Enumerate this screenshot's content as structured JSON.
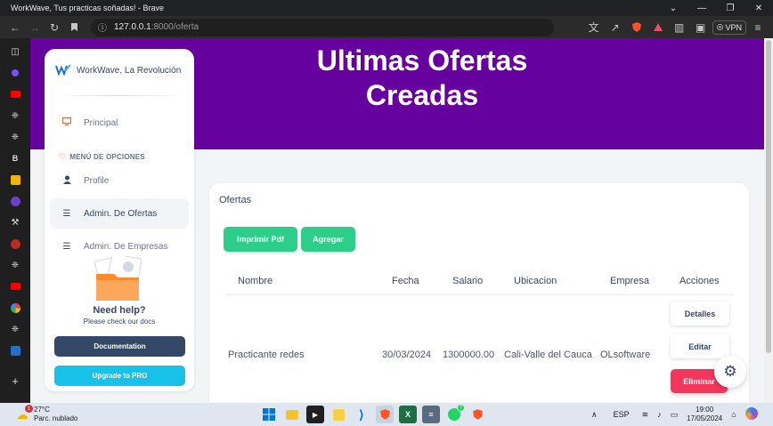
{
  "window": {
    "title": "WorkWave, Tus practicas soñadas! - Brave",
    "controls": {
      "menu": "⌄",
      "minimize": "—",
      "maximize": "❐",
      "close": "✕"
    }
  },
  "browser": {
    "url_host": "127.0.0.1",
    "url_path": ":8000/oferta",
    "vpn_label": "VPN"
  },
  "sidebar": {
    "brand": "WorkWave, La Revolución",
    "items": [
      {
        "label": "Principal",
        "icon": "monitor-icon"
      },
      {
        "label": "Profile",
        "icon": "user-icon"
      },
      {
        "label": "Admin. De Ofertas",
        "icon": "list-icon",
        "active": true
      },
      {
        "label": "Admin. De Empresas",
        "icon": "list-icon"
      }
    ],
    "menu_heading": "MENÚ DE OPCIONES",
    "help_title": "Need help?",
    "help_subtitle": "Please check our docs",
    "doc_button": "Documentation",
    "pro_button": "Upgrade to PRO"
  },
  "hero": {
    "title": "Ultimas Ofertas Creadas"
  },
  "card": {
    "title": "Ofertas",
    "print_button": "Imprimir Pdf",
    "add_button": "Agregar",
    "columns": [
      "Nombre",
      "Fecha",
      "Salario",
      "Ubicacion",
      "Empresa",
      "Acciones"
    ],
    "rows": [
      {
        "nombre": "Practicante redes",
        "fecha": "30/03/2024",
        "salario": "1300000.00",
        "ubicacion": "Cali-Valle del Cauca",
        "empresa": "OLsoftware",
        "actions": {
          "details": "Detalles",
          "edit": "Editar",
          "delete": "Eliminar"
        }
      }
    ]
  },
  "taskbar": {
    "temperature": "27°C",
    "weather": "Parc. nublado",
    "weather_badge": "1",
    "whatsapp_badge": "7",
    "language": "ESP",
    "time": "19:00",
    "date": "17/05/2024"
  },
  "colors": {
    "hero": "#66009e",
    "green": "#2dce89",
    "danger": "#f5365c",
    "dark": "#344767",
    "info": "#17c1e8"
  }
}
